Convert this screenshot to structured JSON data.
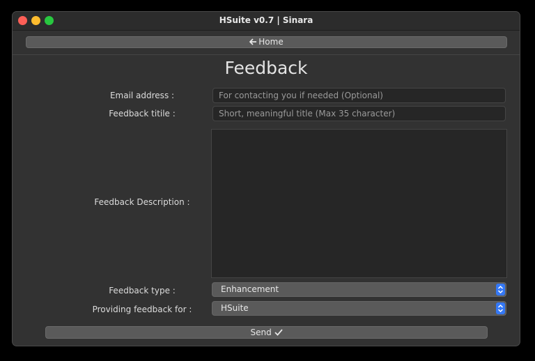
{
  "window": {
    "title": "HSuite v0.7 | Sinara"
  },
  "toolbar": {
    "home_label": "Home",
    "home_icon": "arrow-left-icon"
  },
  "page": {
    "heading": "Feedback"
  },
  "form": {
    "email_label": "Email address :",
    "email_placeholder": "For contacting you if needed (Optional)",
    "title_label": "Feedback titile :",
    "title_placeholder": "Short, meaningful title (Max 35 character)",
    "description_label": "Feedback Description :",
    "type_label": "Feedback type :",
    "type_value": "Enhancement",
    "target_label": "Providing feedback for :",
    "target_value": "HSuite",
    "send_label": "Send",
    "send_icon": "checkmark-icon"
  },
  "colors": {
    "accent": "#3478f6",
    "background": "#323232"
  }
}
